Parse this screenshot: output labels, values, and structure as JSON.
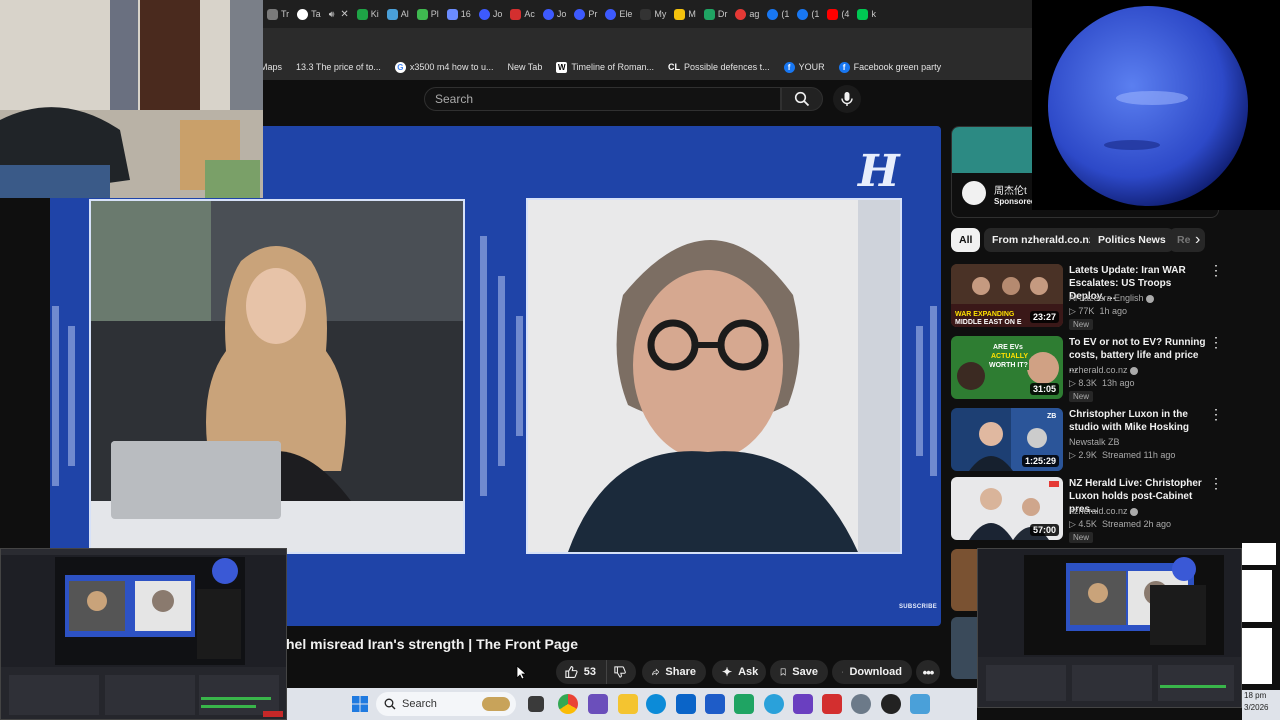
{
  "browser": {
    "tabs": [
      {
        "label": "Tr",
        "color": "#7a7a7a"
      },
      {
        "label": "Ta",
        "color": "#ffffff"
      },
      {
        "label": "",
        "color": "#c8c8c8"
      },
      {
        "label": "Ki",
        "color": "#1ea446"
      },
      {
        "label": "Al",
        "color": "#4aa0d9"
      },
      {
        "label": "Pl",
        "color": "#3fb950"
      },
      {
        "label": "16",
        "color": "#6b8cff"
      },
      {
        "label": "Jo",
        "color": "#3d5afe"
      },
      {
        "label": "Ac",
        "color": "#d32f2f"
      },
      {
        "label": "Jo",
        "color": "#3d5afe"
      },
      {
        "label": "Pr",
        "color": "#3d5afe"
      },
      {
        "label": "Ele",
        "color": "#3d5afe"
      },
      {
        "label": "My",
        "color": "#333333"
      },
      {
        "label": "M",
        "color": "#f4c20d"
      },
      {
        "label": "Dr",
        "color": "#1fa463"
      },
      {
        "label": "ag",
        "color": "#e53935"
      },
      {
        "label": "(1",
        "color": "#1877f2"
      },
      {
        "label": "(1",
        "color": "#1877f2"
      },
      {
        "label": "(4",
        "color": "#ff0000"
      },
      {
        "label": "k",
        "color": "#00c853"
      }
    ],
    "bookmarks": [
      {
        "label": "Maps",
        "icon": ""
      },
      {
        "label": "13.3 The price of to...",
        "icon": ""
      },
      {
        "label": "x3500 m4 how to u...",
        "icon": "G"
      },
      {
        "label": "New Tab",
        "icon": ""
      },
      {
        "label": "Timeline of Roman...",
        "icon": "W"
      },
      {
        "label": "Possible defences t...",
        "icon": "CL"
      },
      {
        "label": "YOUR",
        "icon": "f"
      },
      {
        "label": "Facebook green party",
        "icon": "f"
      }
    ]
  },
  "youtube": {
    "search_placeholder": "Search",
    "video": {
      "channel_logo": "H",
      "subscribe_label": "SUBSCRIBE",
      "title": "hel misread Iran's strength | The Front Page",
      "likes": "53",
      "share_label": "Share",
      "ask_label": "Ask",
      "save_label": "Save",
      "download_label": "Download"
    },
    "sponsored": {
      "title": "周杰伦t",
      "label": "Sponsored"
    },
    "chips": [
      "All",
      "From nzherald.co.nz",
      "Politics News",
      "Re"
    ],
    "related": [
      {
        "title": "Latets Update: Iran WAR Escalates: US Troops Deploy, ...",
        "channel": "Al Jazeera English",
        "views": "77K",
        "age": "1h ago",
        "duration": "23:27",
        "badge": "New",
        "thumb_color": "#5a3a2a",
        "verified": true
      },
      {
        "title": "To EV or not to EV? Running costs, battery life and price ...",
        "channel": "nzherald.co.nz",
        "views": "8.3K",
        "age": "13h ago",
        "duration": "31:05",
        "badge": "New",
        "thumb_color": "#2e7d32",
        "verified": true
      },
      {
        "title": "Christopher Luxon in the studio with Mike Hosking",
        "channel": "Newstalk ZB",
        "views": "2.9K",
        "age": "Streamed 11h ago",
        "duration": "1:25:29",
        "badge": "",
        "thumb_color": "#1d4e89",
        "verified": false
      },
      {
        "title": "NZ Herald Live: Christopher Luxon holds post-Cabinet pres...",
        "channel": "nzherald.co.nz",
        "views": "4.5K",
        "age": "Streamed 2h ago",
        "duration": "57:00",
        "badge": "New",
        "thumb_color": "#2f3a4a",
        "verified": true
      }
    ]
  },
  "taskbar": {
    "search_label": "Search",
    "clock_time": "18 pm",
    "clock_date": "3/2026"
  }
}
